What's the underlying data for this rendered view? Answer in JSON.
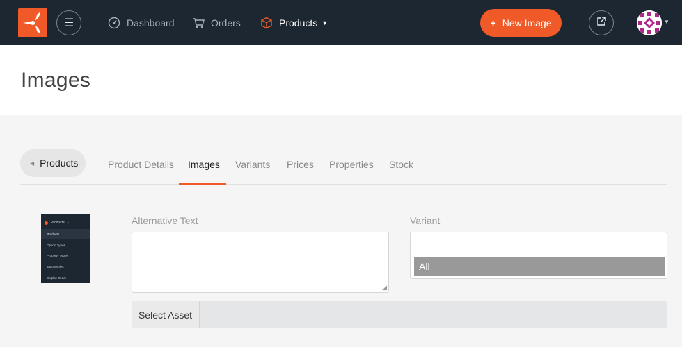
{
  "nav": {
    "dashboard": "Dashboard",
    "orders": "Orders",
    "products": "Products",
    "new_button": "New Image"
  },
  "page": {
    "title": "Images"
  },
  "tabs": {
    "back": "Products",
    "items": [
      "Product Details",
      "Images",
      "Variants",
      "Prices",
      "Properties",
      "Stock"
    ],
    "active": "Images"
  },
  "thumbnail": {
    "header": "Products",
    "items": [
      "Products",
      "Option Types",
      "Property Types",
      "Taxonomies",
      "Display Order"
    ]
  },
  "form": {
    "alt_label": "Alternative Text",
    "alt_value": "",
    "variant_label": "Variant",
    "variant_option": "All",
    "select_asset": "Select Asset"
  },
  "colors": {
    "accent": "#f05a28",
    "nav_bg": "#1d2731"
  }
}
